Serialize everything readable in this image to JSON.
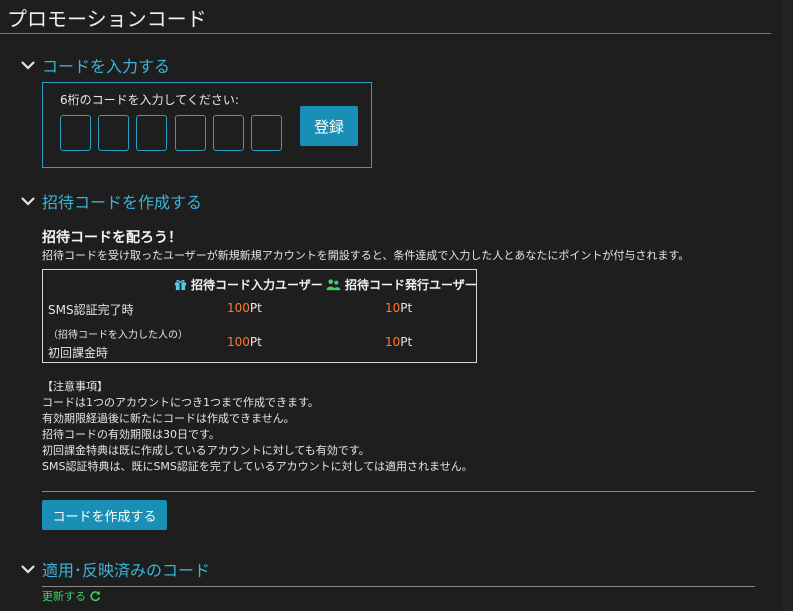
{
  "page": {
    "title": "プロモーションコード"
  },
  "sections": {
    "enter_code": {
      "title": "コードを入力する"
    },
    "create_invite": {
      "title": "招待コードを作成する"
    },
    "applied": {
      "title": "適用･反映済みのコード"
    }
  },
  "code_entry": {
    "label": "6桁のコードを入力してください:",
    "digits": [
      "",
      "",
      "",
      "",
      "",
      ""
    ],
    "register_label": "登録"
  },
  "invite": {
    "heading": "招待コードを配ろう！",
    "description": "招待コードを受け取ったユーザーが新規新規アカウントを開設すると、条件達成で入力した人とあなたにポイントが付与されます。",
    "table": {
      "col_receiver": "招待コード入力ユーザー",
      "col_issuer": "招待コード発行ユーザー",
      "row1": {
        "label": "SMS認証完了時",
        "receiver_num": "100",
        "receiver_unit": "Pt",
        "issuer_num": "10",
        "issuer_unit": "Pt"
      },
      "row2": {
        "label_small": "（招待コードを入力した人の）",
        "label": "初回課金時",
        "receiver_num": "100",
        "receiver_unit": "Pt",
        "issuer_num": "10",
        "issuer_unit": "Pt"
      }
    },
    "notes": [
      "【注意事項】",
      "コードは1つのアカウントにつき1つまで作成できます。",
      "有効期限経過後に新たにコードは作成できません。",
      "招待コードの有効期限は30日です。",
      "初回課金特典は既に作成しているアカウントに対しても有効です。",
      "SMS認証特典は、既にSMS認証を完了しているアカウントに対しては適用されません。"
    ],
    "create_label": "コードを作成する"
  },
  "applied": {
    "refresh_label": "更新する"
  },
  "colors": {
    "accent": "#39b4d6",
    "button": "#1a8fb5",
    "points": "#ff7a2e",
    "refresh": "#3fcf6a",
    "gift_icon": "#4fd0e8",
    "users_icon": "#3fcf6a"
  },
  "icons": [
    "chevron-down-icon",
    "gift-icon",
    "users-icon",
    "refresh-icon"
  ]
}
